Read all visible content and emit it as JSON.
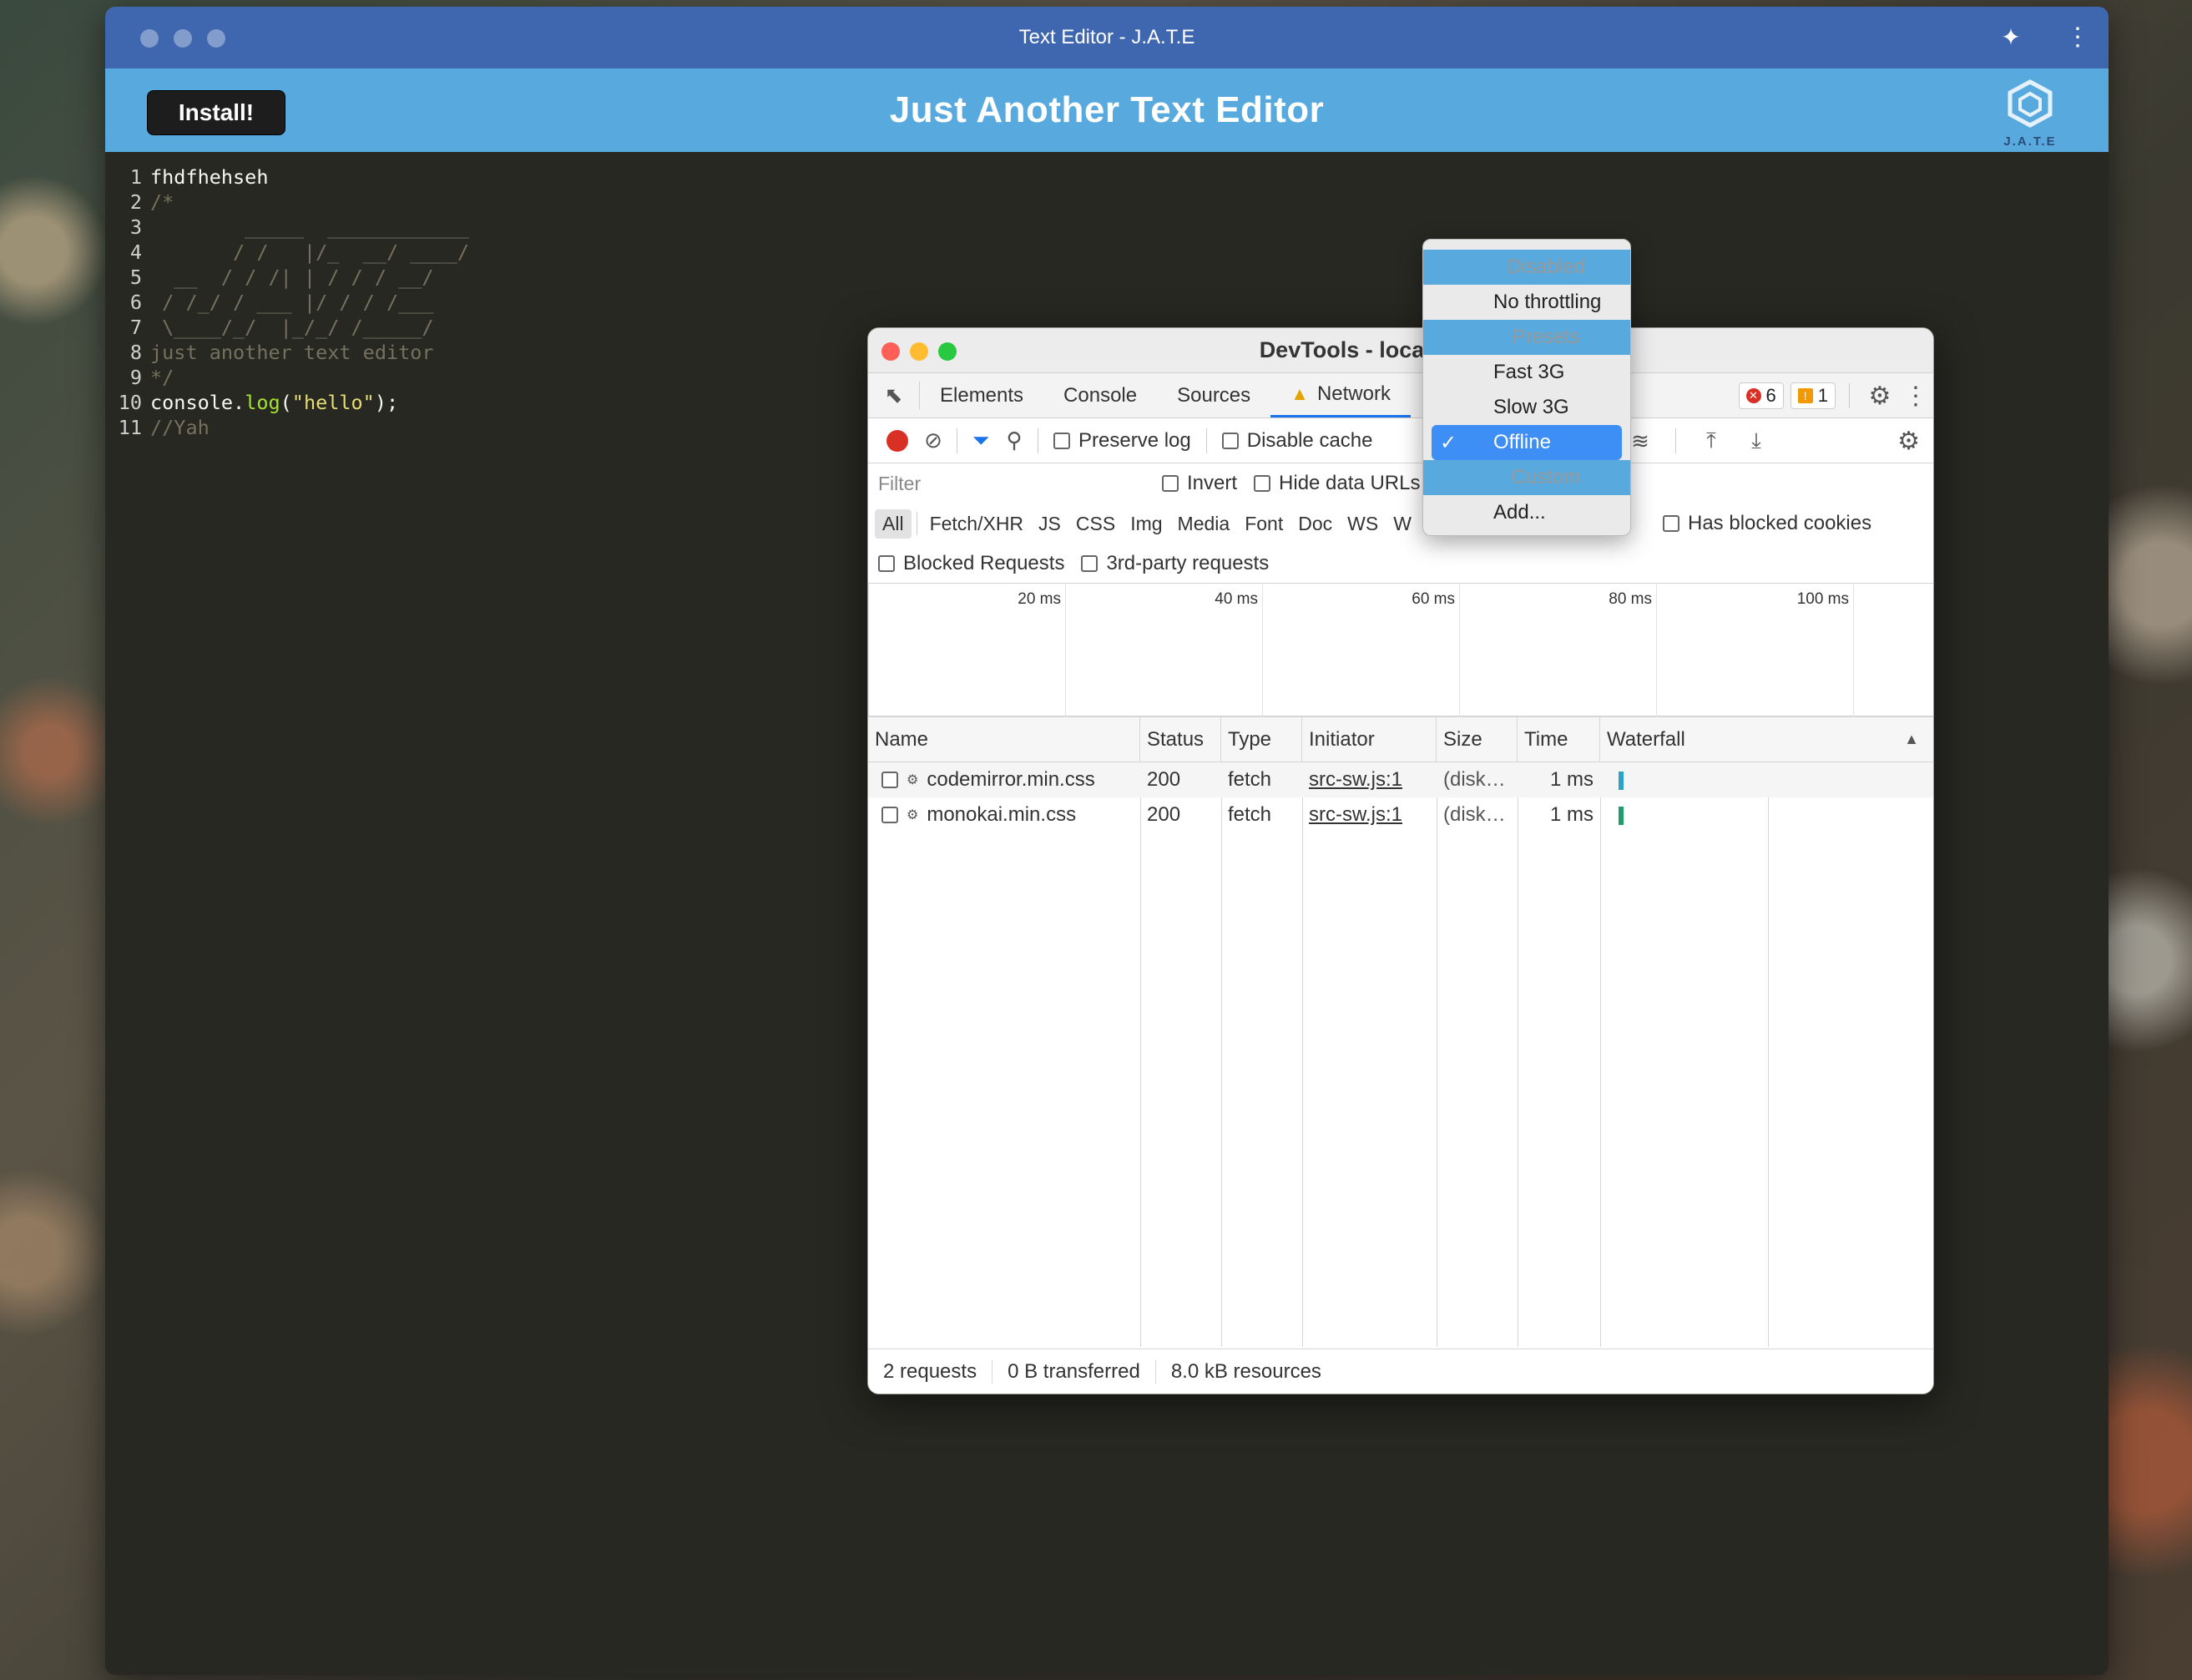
{
  "window": {
    "title": "Text Editor - J.A.T.E"
  },
  "header": {
    "install_label": "Install!",
    "title": "Just Another Text Editor",
    "logo_text": "J.A.T.E"
  },
  "editor": {
    "lines": [
      {
        "num": "1",
        "text": "fhdfhehseh"
      },
      {
        "num": "2",
        "text": "/*"
      },
      {
        "num": "3",
        "text": "        _____  ____________"
      },
      {
        "num": "4",
        "text": "       / /   |/_  __/ ____/"
      },
      {
        "num": "5",
        "text": "  __  / / /| | / / / __/"
      },
      {
        "num": "6",
        "text": " / /_/ / ___ |/ / / /___"
      },
      {
        "num": "7",
        "text": " \\____/_/  |_/_/ /_____/"
      },
      {
        "num": "8",
        "text": "just another text editor"
      },
      {
        "num": "9",
        "text": "*/"
      },
      {
        "num": "10",
        "text_a": "console.",
        "text_fn": "log",
        "text_b": "(",
        "text_str": "\"hello\"",
        "text_c": ");"
      },
      {
        "num": "11",
        "text": "//Yah"
      }
    ]
  },
  "devtools": {
    "title": "DevTools - localhost:8080/",
    "tabs": [
      "Elements",
      "Console",
      "Sources",
      "Network"
    ],
    "active_tab": "Network",
    "error_count": "6",
    "warning_count": "1",
    "toolbar": {
      "preserve_log": "Preserve log",
      "disable_cache": "Disable cache"
    },
    "filter": {
      "placeholder": "Filter",
      "invert": "Invert",
      "hide_data_urls": "Hide data URLs"
    },
    "types": [
      "All",
      "Fetch/XHR",
      "JS",
      "CSS",
      "Img",
      "Media",
      "Font",
      "Doc",
      "WS",
      "W"
    ],
    "has_blocked_cookies": "Has blocked cookies",
    "blocked_requests": "Blocked Requests",
    "third_party": "3rd-party requests",
    "timeline_ticks": [
      "20 ms",
      "40 ms",
      "60 ms",
      "80 ms",
      "100 ms"
    ],
    "columns": [
      "Name",
      "Status",
      "Type",
      "Initiator",
      "Size",
      "Time",
      "Waterfall"
    ],
    "rows": [
      {
        "name": "codemirror.min.css",
        "status": "200",
        "type": "fetch",
        "initiator": "src-sw.js:1",
        "size": "(disk…",
        "time": "1 ms"
      },
      {
        "name": "monokai.min.css",
        "status": "200",
        "type": "fetch",
        "initiator": "src-sw.js:1",
        "size": "(disk…",
        "time": "1 ms"
      }
    ],
    "status": {
      "requests": "2 requests",
      "transferred": "0 B transferred",
      "resources": "8.0 kB resources"
    }
  },
  "throttle_menu": {
    "disabled_header": "Disabled",
    "no_throttling": "No throttling",
    "presets_header": "Presets",
    "fast3g": "Fast 3G",
    "slow3g": "Slow 3G",
    "offline": "Offline",
    "custom_header": "Custom",
    "add": "Add..."
  },
  "colors": {
    "titlebar": "#3f67b0",
    "header": "#58a9de",
    "editor_bg": "#272822",
    "selection": "#3d8ef5"
  }
}
